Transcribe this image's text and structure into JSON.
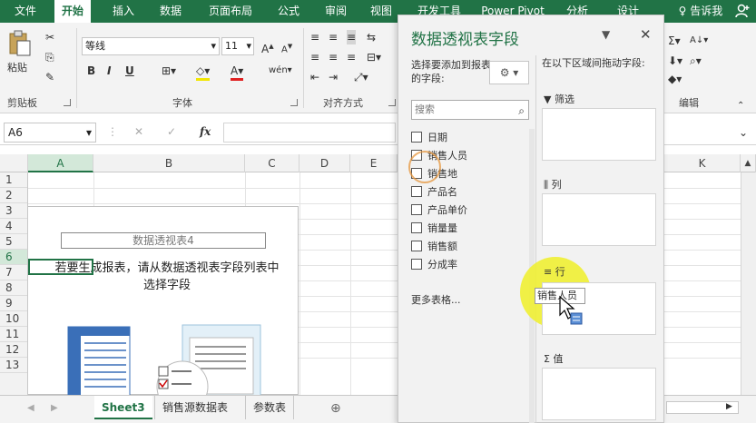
{
  "ribbon_tabs": [
    "文件",
    "开始",
    "插入",
    "数据",
    "页面布局",
    "公式",
    "审阅",
    "视图",
    "开发工具",
    "Power Pivot",
    "分析",
    "设计"
  ],
  "tell_me": "告诉我",
  "ribbon": {
    "paste": "粘贴",
    "font_name": "等线",
    "font_size": "11",
    "group_clipboard": "剪贴板",
    "group_font": "字体",
    "group_align": "对齐方式",
    "group_edit": "编辑",
    "bold": "B",
    "italic": "I",
    "underline": "U",
    "fx": "fx"
  },
  "name_box": "A6",
  "columns": [
    "A",
    "B",
    "C",
    "D",
    "E",
    "K"
  ],
  "rows": [
    "1",
    "2",
    "3",
    "4",
    "5",
    "6",
    "7",
    "8",
    "9",
    "10",
    "11",
    "12",
    "13"
  ],
  "pivot": {
    "title": "数据透视表4",
    "message_line1": "若要生成报表，请从数据透视表字段列表中",
    "message_line2": "选择字段"
  },
  "sheet_tabs": [
    "Sheet3",
    "销售源数据表",
    "参数表"
  ],
  "add_sheet": "⊕",
  "pane": {
    "title": "数据透视表字段",
    "choose_label": "选择要添加到报表的字段:",
    "drag_label": "在以下区域间拖动字段:",
    "search_placeholder": "搜索",
    "fields": [
      "日期",
      "销售人员",
      "销售地",
      "产品名",
      "产品单价",
      "销量量",
      "销售额",
      "分成率"
    ],
    "more_tables": "更多表格...",
    "area_filter": "筛选",
    "area_columns": "列",
    "area_rows": "行",
    "area_values": "值",
    "dragged_field": "销售人员"
  },
  "colors": {
    "excel_green": "#217346",
    "highlight_yellow": "#f0f028"
  }
}
